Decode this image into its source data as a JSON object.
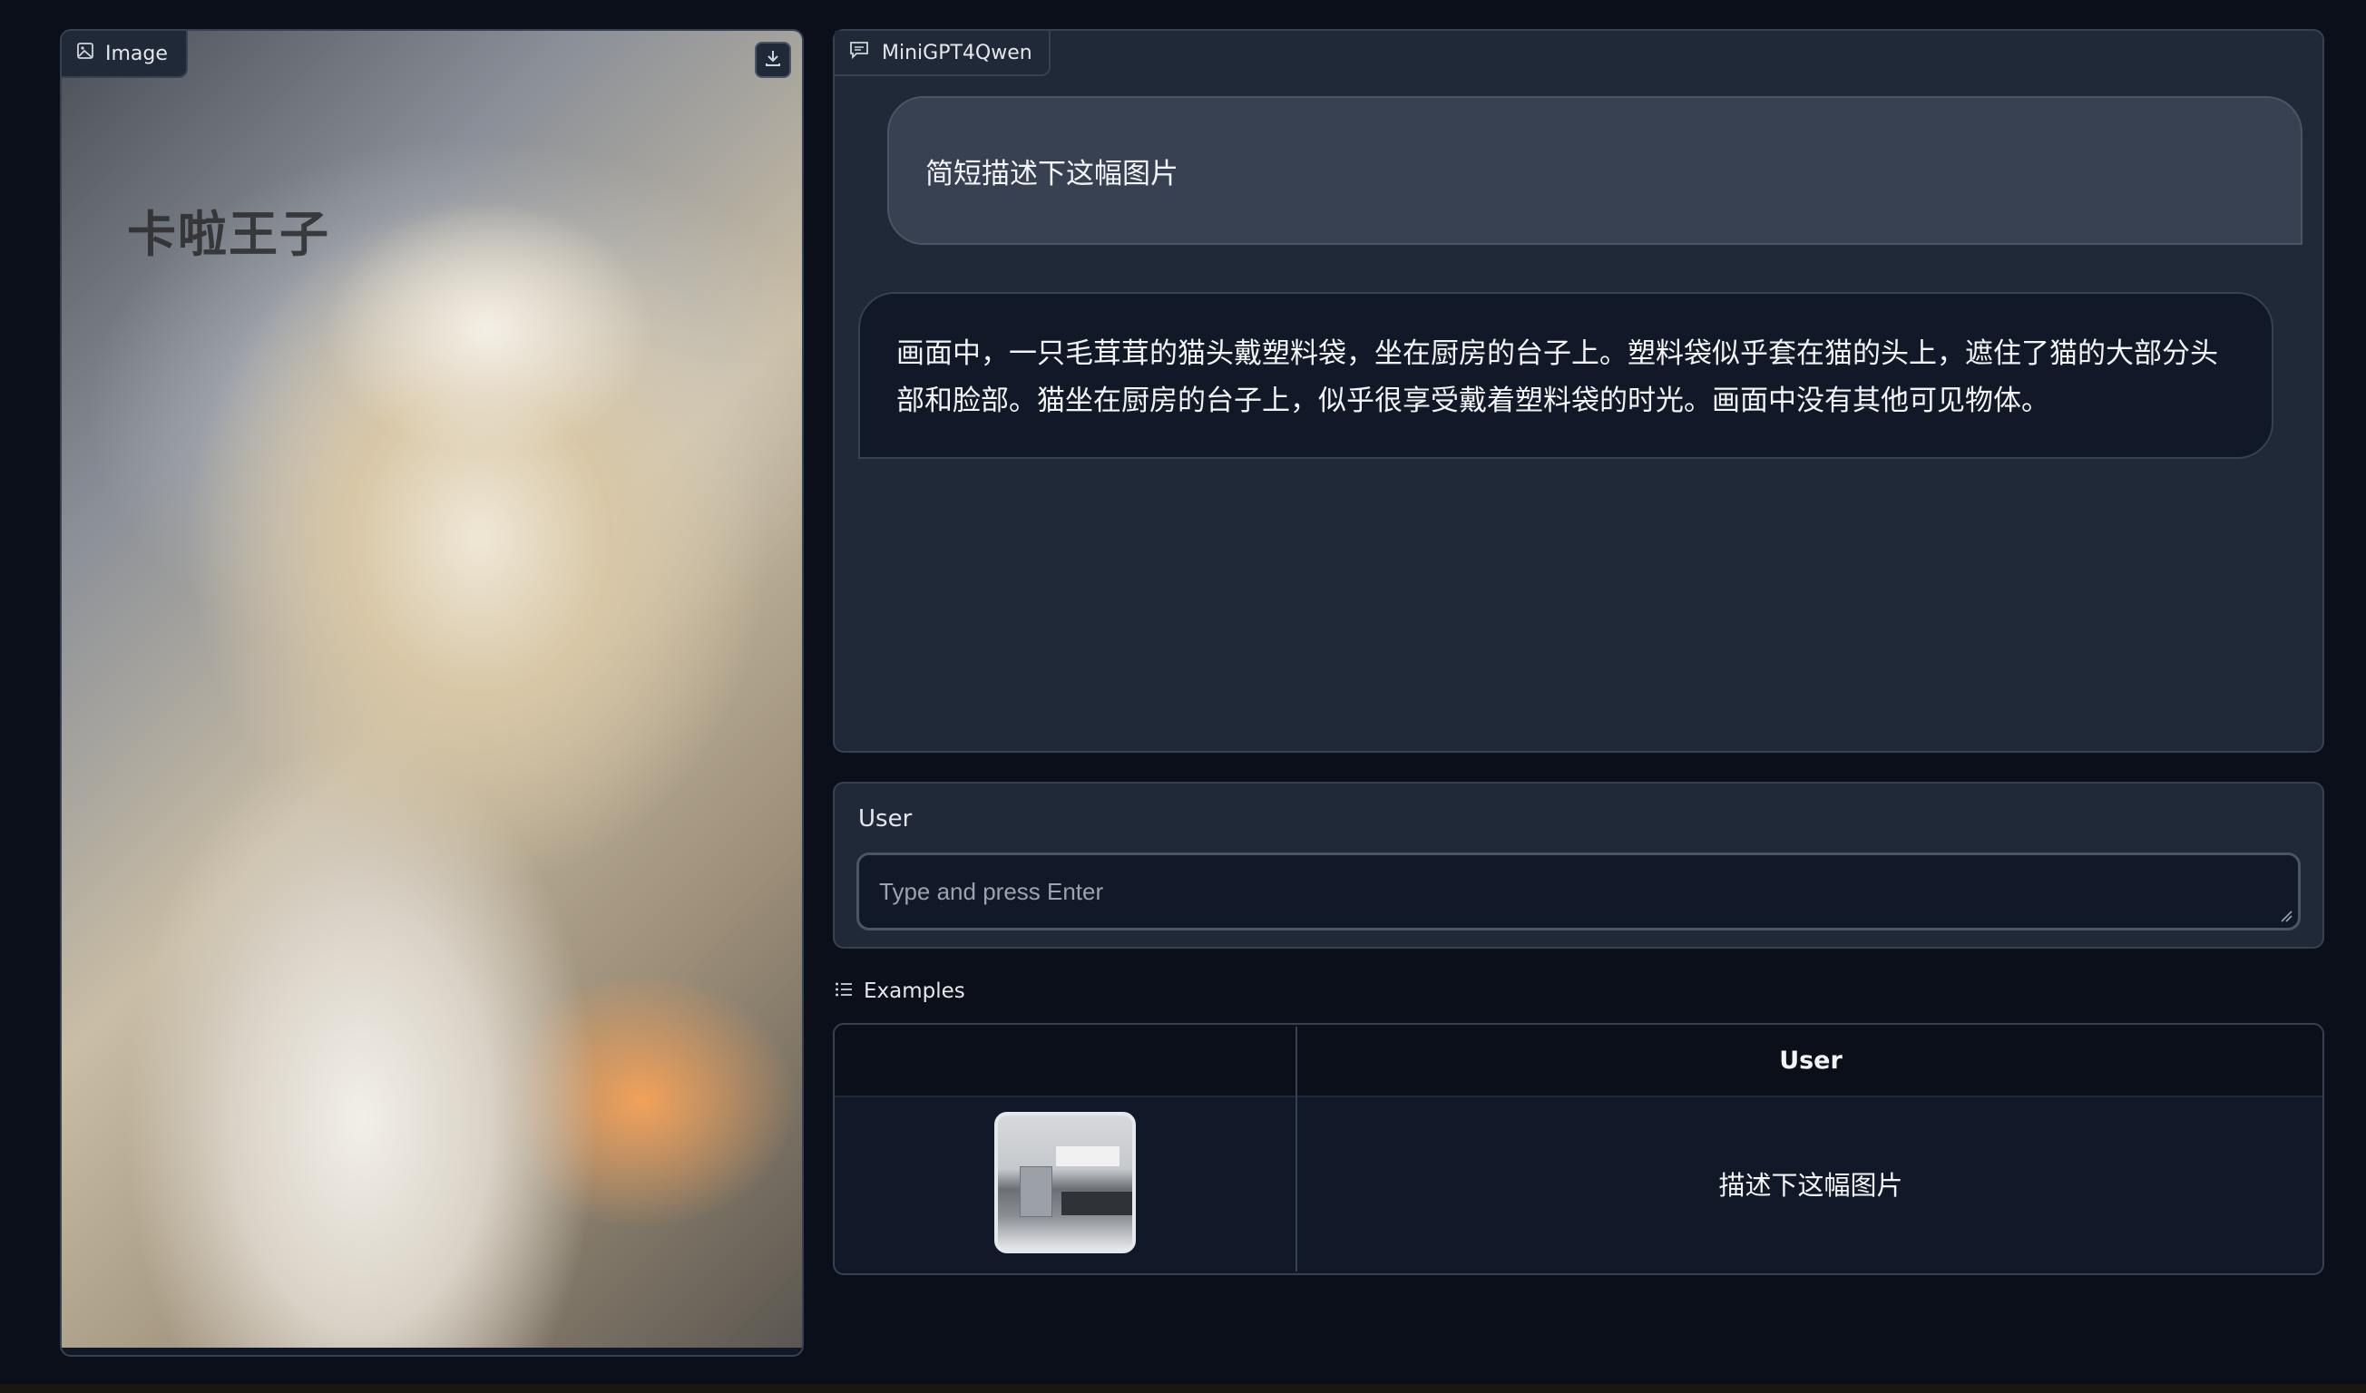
{
  "image_panel": {
    "label": "Image",
    "photo_text": "卡啦王子"
  },
  "chatbot": {
    "label": "MiniGPT4Qwen",
    "messages": [
      {
        "role": "user",
        "text": "简短描述下这幅图片"
      },
      {
        "role": "bot",
        "text": "画面中，一只毛茸茸的猫头戴塑料袋，坐在厨房的台子上。塑料袋似乎套在猫的头上，遮住了猫的大部分头部和脸部。猫坐在厨房的台子上，似乎很享受戴着塑料袋的时光。画面中没有其他可见物体。"
      }
    ]
  },
  "user_input": {
    "label": "User",
    "value": "",
    "placeholder": "Type and press Enter"
  },
  "examples": {
    "label": "Examples",
    "columns": [
      "",
      "User"
    ],
    "rows": [
      {
        "image": "kitchen-thumbnail",
        "text": "描述下这幅图片"
      }
    ]
  },
  "icons": {
    "image_label": "image-icon",
    "download": "download-icon",
    "chat_label": "chat-icon",
    "examples": "list-icon"
  },
  "colors": {
    "background": "#0b0f19",
    "panel": "#1f2937",
    "border": "#374151",
    "user_bubble": "#374151",
    "bot_bubble": "#111827"
  }
}
